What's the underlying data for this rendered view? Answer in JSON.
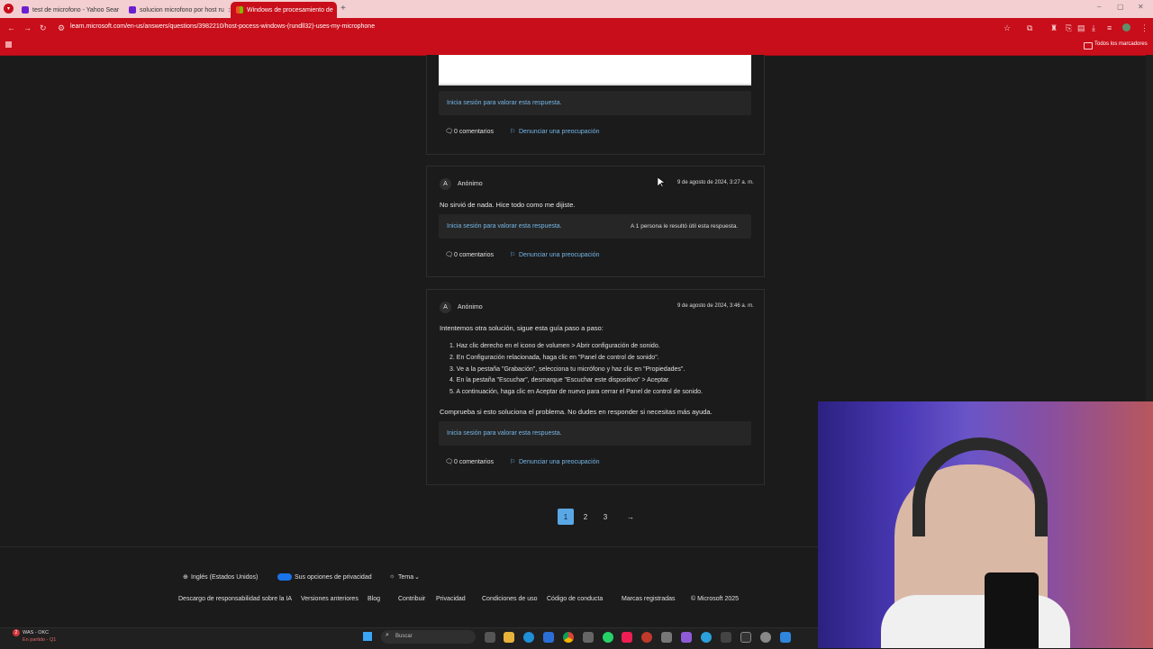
{
  "browser": {
    "tabs": [
      {
        "label": "test de microfono - Yahoo Sear",
        "favicon_color": "#6b1fd1"
      },
      {
        "label": "solucion microfono por host ru",
        "favicon_color": "#6b1fd1"
      },
      {
        "label": "Windows de procesamiento de",
        "favicon_color": "#f25022"
      }
    ],
    "url": "learn.microsoft.com/en-us/answers/questions/3982210/host-pocess-windows-(rundll32)-uses-my-microphone",
    "bookmarks_label": "Todos los marcadores"
  },
  "answers": [
    {
      "rate_text": "Inicia sesión para valorar esta respuesta.",
      "comments": "0 comentarios",
      "report": "Denunciar una preocupación"
    },
    {
      "avatar": "A",
      "author": "Anónimo",
      "date": "9 de agosto de 2024, 3:27 a. m.",
      "body": "No sirvió de nada. Hice todo como me dijiste.",
      "rate_text": "Inicia sesión para valorar esta respuesta.",
      "helpful": "A 1 persona le resultó útil esta respuesta.",
      "comments": "0 comentarios",
      "report": "Denunciar una preocupación"
    },
    {
      "avatar": "A",
      "author": "Anónimo",
      "date": "9 de agosto de 2024, 3:46 a. m.",
      "intro": "Intentemos otra solución, sigue esta guía paso a paso:",
      "steps": [
        "1. Haz clic derecho en el icono de volumen > Abrir configuración de sonido.",
        "2. En Configuración relacionada, haga clic en \"Panel de control de sonido\".",
        "3. Ve a la pestaña \"Grabación\", selecciona tu micrófono y haz clic en \"Propiedades\".",
        "4. En la pestaña \"Escuchar\", desmarque \"Escuchar este dispositivo\" > Aceptar.",
        "5. A continuación, haga clic en Aceptar de nuevo para cerrar el Panel de control de sonido."
      ],
      "outro": "Comprueba si esto soluciona el problema. No dudes en responder si necesitas más ayuda.",
      "rate_text": "Inicia sesión para valorar esta respuesta.",
      "comments": "0 comentarios",
      "report": "Denunciar una preocupación"
    }
  ],
  "pagination": {
    "pages": [
      "1",
      "2",
      "3"
    ],
    "current": "1",
    "next": "→"
  },
  "footer": {
    "language": "Inglés (Estados Unidos)",
    "privacy": "Sus opciones de privacidad",
    "theme": "Tema",
    "links": [
      "Descargo de responsabilidad sobre la IA",
      "Versiones anteriores",
      "Blog",
      "Contribuir",
      "Privacidad",
      "Condiciones de uso",
      "Código de conducta",
      "Marcas registradas",
      "© Microsoft 2025"
    ]
  },
  "taskbar": {
    "weather_badge": "2",
    "weather_title": "WAS - OKC",
    "weather_sub": "En partido - Q1",
    "search_placeholder": "Buscar"
  },
  "colors": {
    "browser_red": "#c80e1a",
    "link_blue": "#75b6e7",
    "page_active": "#5aa7e6"
  }
}
